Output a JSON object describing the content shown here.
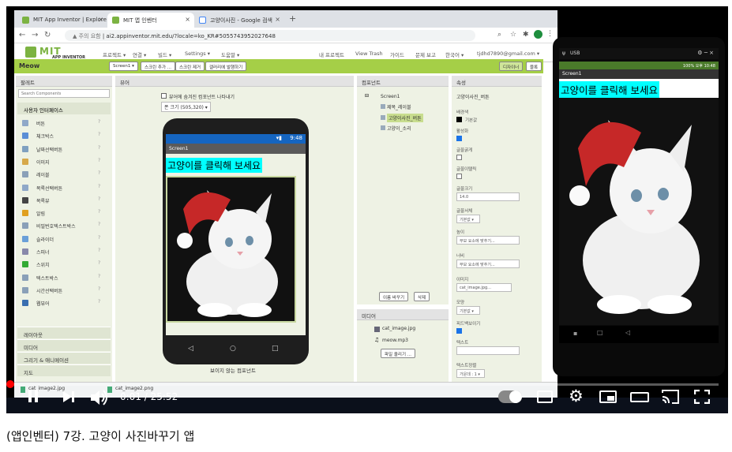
{
  "browser": {
    "tabs": [
      "MIT App Inventor | Explore MIT",
      "MIT 앱 인벤터",
      "고양이사진 - Google 검색"
    ],
    "new_tab": "+",
    "not_secure": "주의 요함",
    "url": "ai2.appinventor.mit.edu/?locale=ko_KR#5055743952027648"
  },
  "app": {
    "logo": "MIT",
    "logo_sub": "APP INVENTOR",
    "menu": [
      "프로젝트 ▾",
      "연결 ▾",
      "빌드 ▾",
      "Settings ▾",
      "도움말 ▾"
    ],
    "right_menu": [
      "내 프로젝트",
      "View Trash",
      "가이드",
      "문제 보고",
      "한국어 ▾",
      "tjdhd7890@gmail.com ▾"
    ],
    "project_name": "Meow",
    "screen_select": "Screen1 ▾",
    "add_screen": "스크린 추가 ...",
    "remove_screen": "스크린 제거",
    "checkpoint": "갤러리에 발행하기",
    "designer": "디자이너",
    "blocks": "블록"
  },
  "palette": {
    "header": "팔레트",
    "search_placeholder": "Search Components",
    "user_interface": "사용자 인터페이스",
    "items": [
      "버튼",
      "체크박스",
      "날짜선택버튼",
      "이미지",
      "레이블",
      "목록선택버튼",
      "목록뷰",
      "알림",
      "비밀번호텍스트박스",
      "슬라이더",
      "스피너",
      "스위치",
      "텍스트박스",
      "시간선택버튼",
      "웹뷰어"
    ],
    "help": "?",
    "categories": [
      "레이아웃",
      "미디어",
      "그리기 & 애니메이션",
      "지도"
    ]
  },
  "viewer": {
    "header": "뷰어",
    "checkbox_label": "뷰어에 숨겨진 컴포넌트 나타내기",
    "size_select": "폰 크기 (505,320) ▾",
    "status_time": "9:48",
    "screen_title": "Screen1",
    "label_text": "고양이를 클릭해 보세요",
    "nonvisible": "보이지 않는 컴포넌트"
  },
  "components": {
    "header": "컴포넌트",
    "tree": [
      "Screen1",
      "제목_레이블",
      "고양이사진_버튼",
      "고양이_소리"
    ],
    "rename": "이름 바꾸기",
    "delete": "삭제"
  },
  "media": {
    "header": "미디어",
    "files": [
      "cat_image.jpg",
      "meow.mp3"
    ],
    "upload": "파일 올리기 ..."
  },
  "properties": {
    "header": "속성",
    "component": "고양이사진_버튼",
    "bgcolor_label": "배경색",
    "bgcolor_value": "기본값",
    "enabled_label": "활성화",
    "bold_label": "글꼴굵게",
    "italic_label": "글꼴이탤릭",
    "fontsize_label": "글꼴크기",
    "fontsize_value": "14.0",
    "typeface_label": "글꼴서체",
    "typeface_value": "기본값 ▾",
    "height_label": "높이",
    "height_value": "부모 요소에 맞추기...",
    "width_label": "너비",
    "width_value": "부모 요소에 맞추기...",
    "image_label": "이미지",
    "image_value": "cat_image.jpg...",
    "shape_label": "모양",
    "shape_value": "기본값 ▾",
    "feedback_label": "피드백보이기",
    "text_label": "텍스트",
    "align_label": "텍스트정렬",
    "align_value": "가운데 : 1 ▾"
  },
  "mirror": {
    "status_left": "USB",
    "status_right": "100% 오후 10:48",
    "screen_title": "Screen1",
    "label_text": "고양이를 클릭해 보세요"
  },
  "downloads": [
    "cat_image2.jpg",
    "cat_image2.png"
  ],
  "player": {
    "time": "0:01 / 25:52",
    "progress": 0.0006
  },
  "caption": "(앱인벤터) 7강. 고양이 사진바꾸기 앱",
  "colors": {
    "green": "#a5cf47",
    "cyan_label": "#00ffff",
    "accent": "#1a73e8"
  }
}
